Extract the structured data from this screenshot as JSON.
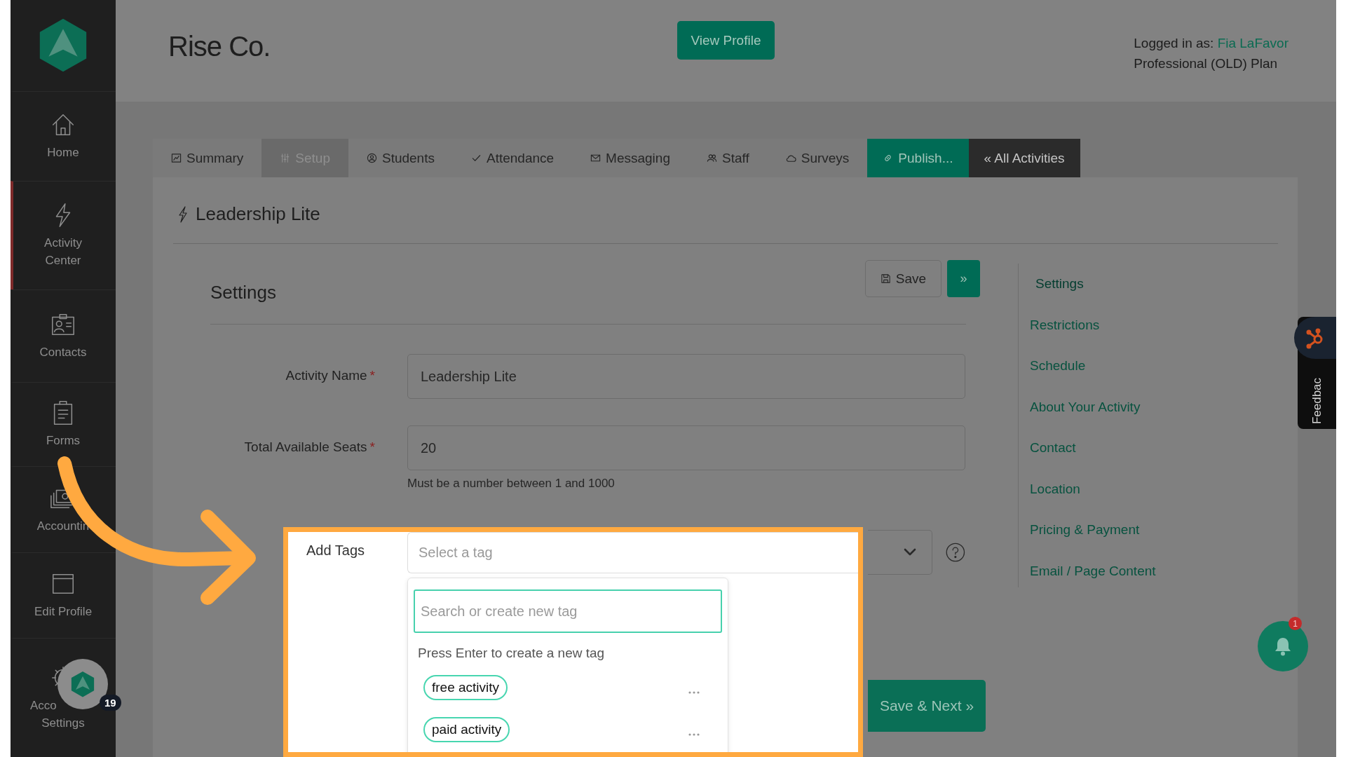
{
  "sidebar": {
    "items": [
      {
        "lines": [
          "Home"
        ],
        "selected": false,
        "partial": false
      },
      {
        "lines": [
          "Activity",
          "Center"
        ],
        "selected": true,
        "partial": false
      },
      {
        "lines": [
          "Contacts"
        ],
        "selected": false,
        "partial": false
      },
      {
        "lines": [
          "Forms"
        ],
        "selected": false,
        "partial": false
      },
      {
        "lines": [
          "Accountin"
        ],
        "selected": false,
        "partial": false
      },
      {
        "lines": [
          "Edit Profile"
        ],
        "selected": false,
        "partial": false
      },
      {
        "lines": [
          "Acco",
          "Settings"
        ],
        "selected": false,
        "partial": true
      }
    ],
    "launcher": {
      "badge": "19"
    }
  },
  "header": {
    "title": "Rise Co.",
    "button": "View Profile",
    "logged_in_label": "Logged in as:",
    "user_name": "Fia LaFavor",
    "plan": "Professional (OLD) Plan"
  },
  "tabs": [
    {
      "label": "Summary",
      "selected": false,
      "kind": "normal"
    },
    {
      "label": "Setup",
      "selected": true,
      "kind": "normal"
    },
    {
      "label": "Students",
      "selected": false,
      "kind": "normal"
    },
    {
      "label": "Attendance",
      "selected": false,
      "kind": "normal"
    },
    {
      "label": "Messaging",
      "selected": false,
      "kind": "normal"
    },
    {
      "label": "Staff",
      "selected": false,
      "kind": "normal"
    },
    {
      "label": "Surveys",
      "selected": false,
      "kind": "normal"
    },
    {
      "label": "Publish...",
      "selected": false,
      "kind": "accent"
    },
    {
      "label": "« All Activities",
      "selected": false,
      "kind": "dark"
    }
  ],
  "page_title": "Leadership Lite",
  "section": {
    "title": "Settings",
    "save_button": "Save",
    "next_button": "»"
  },
  "fields": [
    {
      "label": "Activity Name",
      "required_mark": "*",
      "value": "Leadership Lite"
    },
    {
      "label": "Total Available Seats",
      "required_mark": "*",
      "value": "20",
      "hint": "Must be a number between 1 and 1000"
    }
  ],
  "tags": {
    "label": "Add Tags",
    "placeholder": "Select a tag",
    "search_placeholder": "Search or create new tag",
    "hint": "Press Enter to create a new tag",
    "options": [
      "free activity",
      "paid activity"
    ]
  },
  "save_next_button": "Save & Next »",
  "side_nav": {
    "items": [
      {
        "label": "Settings",
        "selected": true
      },
      {
        "label": "Restrictions",
        "selected": false
      },
      {
        "label": "Schedule",
        "selected": false
      },
      {
        "label": "About Your Activity",
        "selected": false
      },
      {
        "label": "Contact",
        "selected": false
      },
      {
        "label": "Location",
        "selected": false
      },
      {
        "label": "Pricing & Payment",
        "selected": false
      },
      {
        "label": "Email / Page Content",
        "selected": false
      }
    ]
  },
  "feedback": {
    "label": "Feedbac"
  },
  "notifications": {
    "badge": "1"
  }
}
